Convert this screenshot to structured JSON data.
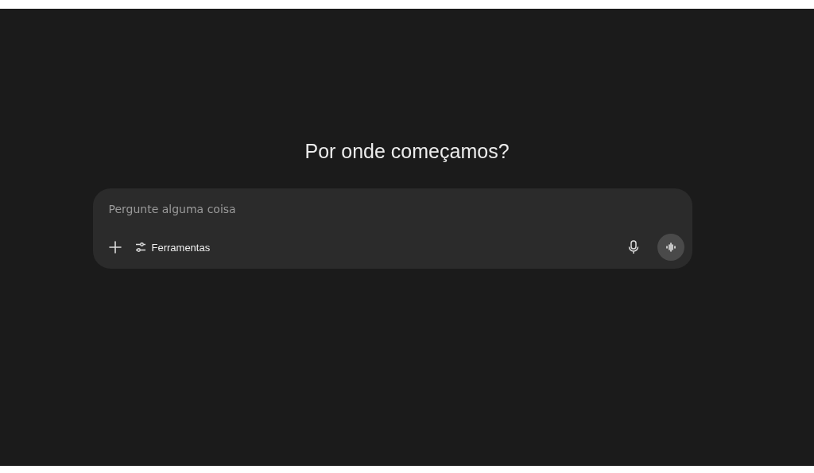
{
  "heading": "Por onde começamos?",
  "composer": {
    "placeholder": "Pergunte alguma coisa",
    "tools_label": "Ferramentas"
  }
}
